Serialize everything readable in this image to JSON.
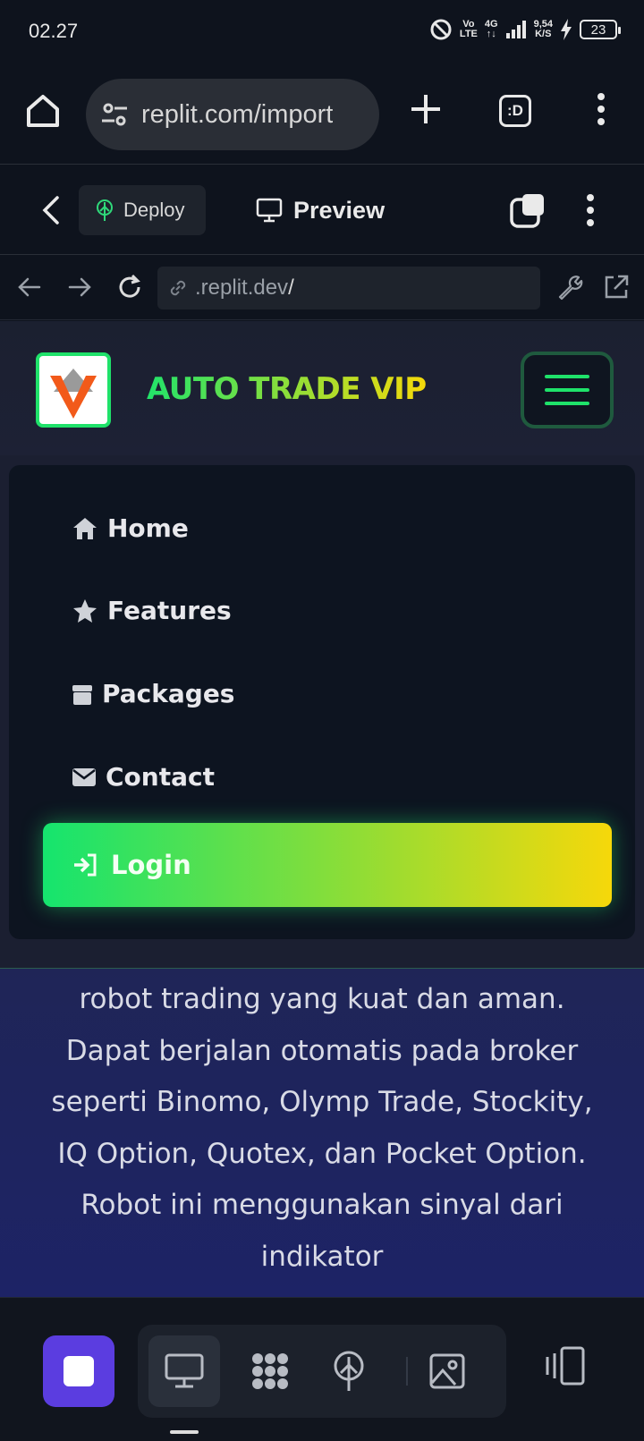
{
  "status_bar": {
    "time": "02.27",
    "network_top": "Vo",
    "network_bottom": "LTE",
    "signal_type": "4G",
    "speed_value": "9,54",
    "speed_unit": "K/S",
    "battery": "23"
  },
  "browser": {
    "url": "replit.com/import",
    "tabs_label": ":D"
  },
  "replit_toolbar": {
    "deploy_label": "Deploy",
    "preview_label": "Preview"
  },
  "webview": {
    "address_prefix": ".replit.dev",
    "address_suffix": "/"
  },
  "site": {
    "brand": "AUTO TRADE VIP",
    "nav_items": [
      {
        "label": "Home",
        "icon": "home-icon"
      },
      {
        "label": "Features",
        "icon": "star-icon"
      },
      {
        "label": "Packages",
        "icon": "box-icon"
      },
      {
        "label": "Contact",
        "icon": "envelope-icon"
      }
    ],
    "login_label": "Login",
    "hero_text": "robot trading yang kuat dan aman. Dapat berjalan otomatis pada broker seperti Binomo, Olymp Trade, Stockity, IQ Option, Quotex, dan Pocket Option. Robot ini menggunakan sinyal dari indikator"
  },
  "colors": {
    "accent_green": "#1fe26a",
    "accent_yellow": "#f5d90a",
    "replit_purple": "#5b3de0"
  }
}
